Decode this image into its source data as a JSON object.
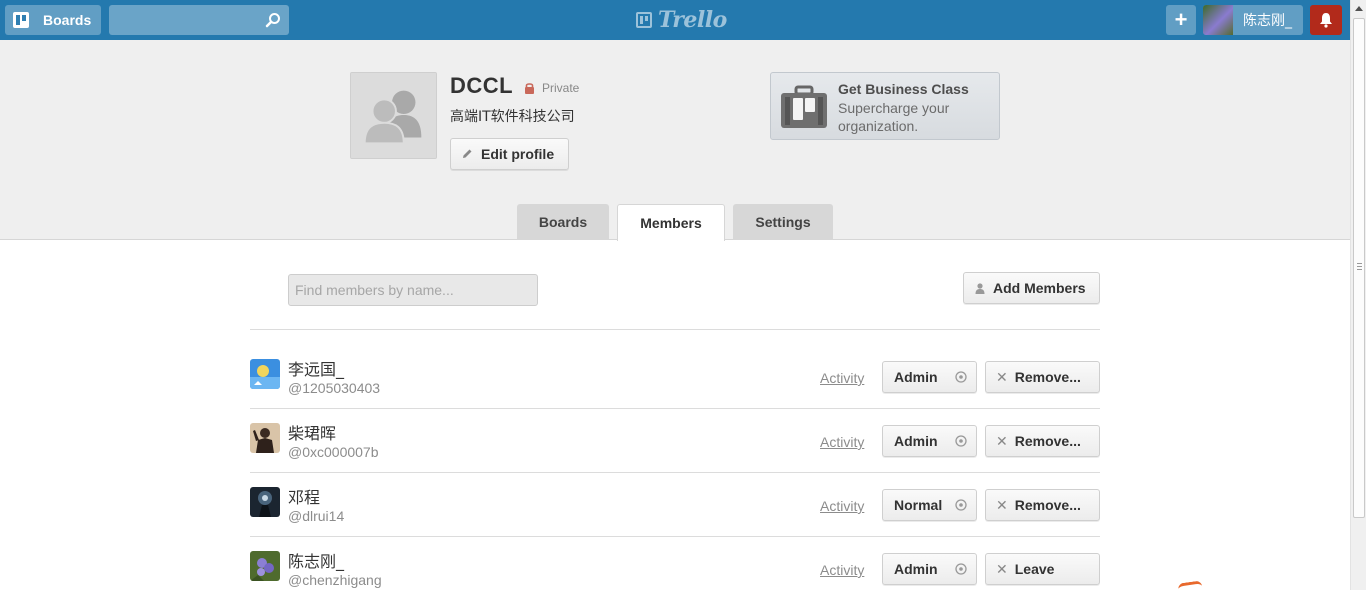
{
  "header": {
    "boards_label": "Boards",
    "search": {
      "value": "",
      "placeholder": ""
    },
    "logo_text": "Trello",
    "user_name": "陈志刚_"
  },
  "org": {
    "name": "DCCL",
    "visibility": "Private",
    "description": "高端IT软件科技公司",
    "edit_label": "Edit profile"
  },
  "business": {
    "title": "Get Business Class",
    "subtitle": "Supercharge your organization."
  },
  "tabs": [
    {
      "label": "Boards",
      "active": false
    },
    {
      "label": "Members",
      "active": true
    },
    {
      "label": "Settings",
      "active": false
    }
  ],
  "members_panel": {
    "find_placeholder": "Find members by name...",
    "add_label": "Add Members"
  },
  "members": [
    {
      "name": "李远国_",
      "handle": "@1205030403",
      "activity": "Activity",
      "role": "Admin",
      "action": "Remove..."
    },
    {
      "name": "柴珺晖",
      "handle": "@0xc000007b",
      "activity": "Activity",
      "role": "Admin",
      "action": "Remove..."
    },
    {
      "name": "邓程",
      "handle": "@dlrui14",
      "activity": "Activity",
      "role": "Normal",
      "action": "Remove..."
    },
    {
      "name": "陈志刚_",
      "handle": "@chenzhigang",
      "activity": "Activity",
      "role": "Admin",
      "action": "Leave"
    }
  ],
  "colors": {
    "header": "#2479ae",
    "notification": "#b22a1b",
    "band": "#efefef"
  }
}
